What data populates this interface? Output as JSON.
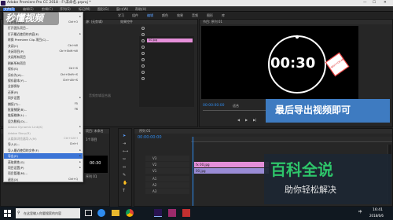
{
  "app": {
    "title": "Adobe Premiere Pro CC 2018 - F:\\未命名.prproj *",
    "menus": [
      "文件(F)",
      "编辑(E)",
      "剪辑(C)",
      "序列(S)",
      "标记(M)",
      "图形(G)",
      "窗口(W)",
      "帮助(H)"
    ]
  },
  "watermark_top": "秒懂视频",
  "header_tabs": [
    "学习",
    "组件",
    "编辑",
    "颜色",
    "效果",
    "音频",
    "图形",
    "库"
  ],
  "source_panel": {
    "tab": "源: (无剪辑)",
    "effects_tab": "效果控件",
    "mixer_tab": "音频剪辑混合器",
    "metadata_tab": "元数据"
  },
  "program_panel": {
    "tab": "节目: 序列 01",
    "clock_text": "00:30",
    "stamp_text": "WAIT FOR ME",
    "timecode": "00:00:00:00",
    "fit": "适合",
    "full": "完整"
  },
  "banner": {
    "text": "最后导出视频即可"
  },
  "baike": {
    "title": "百科全说",
    "subtitle": "助你轻松解决"
  },
  "project_panel": {
    "tab": "项目: 未命名",
    "clip": "序列 01",
    "mini_time": "00:30",
    "item_count": "1个项目"
  },
  "timeline": {
    "tab": "序列 01",
    "timecode": "00:00:00:00",
    "video_tracks": [
      "V3",
      "V2",
      "V1"
    ],
    "audio_tracks": [
      "A1",
      "A2",
      "A3"
    ],
    "clip_v1": "fx 00.jpg",
    "clip_v2": "00.jpg"
  },
  "file_menu": [
    {
      "label": "新建(N)",
      "shortcut": "",
      "submenu": true
    },
    {
      "label": "打开项目(O)...",
      "shortcut": "Ctrl+O"
    },
    {
      "label": "打开团队项目...",
      "shortcut": ""
    },
    {
      "label": "打开最近使用的内容(E)",
      "shortcut": "",
      "submenu": true
    },
    {
      "label": "转换 Premiere Clip 项目(C)...",
      "shortcut": ""
    },
    {
      "label": "关闭(C)",
      "shortcut": "Ctrl+W"
    },
    {
      "label": "关闭项目(P)",
      "shortcut": "Ctrl+Shift+W"
    },
    {
      "label": "关闭所有项目",
      "shortcut": ""
    },
    {
      "label": "刷新所有项目",
      "shortcut": ""
    },
    {
      "label": "保存(S)",
      "shortcut": "Ctrl+S"
    },
    {
      "label": "另存为(A)...",
      "shortcut": "Ctrl+Shift+S"
    },
    {
      "label": "保存副本(Y)...",
      "shortcut": "Ctrl+Alt+S"
    },
    {
      "label": "全部保存",
      "shortcut": ""
    },
    {
      "label": "还原(R)",
      "shortcut": ""
    },
    {
      "label": "同步设置",
      "shortcut": "",
      "submenu": true
    },
    {
      "label": "捕捉(T)...",
      "shortcut": "F5"
    },
    {
      "label": "批量捕捉(B)...",
      "shortcut": "F6"
    },
    {
      "label": "链接媒体(L)...",
      "shortcut": ""
    },
    {
      "label": "设为脱机(O)...",
      "shortcut": ""
    },
    {
      "label": "Adobe Dynamic Link(K)",
      "shortcut": "",
      "submenu": true,
      "disabled": true
    },
    {
      "label": "Adobe Story(R)",
      "shortcut": "",
      "submenu": true,
      "disabled": true
    },
    {
      "label": "从媒体浏览器导入(M)",
      "shortcut": "Ctrl+Alt+I",
      "disabled": true
    },
    {
      "label": "导入(I)...",
      "shortcut": "Ctrl+I"
    },
    {
      "label": "导入最近使用的文件(F)",
      "shortcut": "",
      "submenu": true
    },
    {
      "label": "导出(E)",
      "shortcut": "",
      "submenu": true,
      "highlight": true
    },
    {
      "label": "获取属性(G)",
      "shortcut": "",
      "submenu": true
    },
    {
      "label": "项目设置(P)",
      "shortcut": "",
      "submenu": true
    },
    {
      "label": "项目管理(M)...",
      "shortcut": ""
    },
    {
      "label": "退出(X)",
      "shortcut": "Ctrl+Q"
    }
  ],
  "taskbar": {
    "search_placeholder": "在这里输入你要搜索的内容",
    "time": "16:41",
    "date": "2018/6/6",
    "lang": "中"
  },
  "colors": {
    "accent_blue": "#2e8cf0",
    "menu_highlight": "#3b74d6",
    "clip_pink": "#e58fd9",
    "clip_purple": "#9a8cd6",
    "banner_blue": "#4182cd",
    "baike_green": "#2ec56a"
  }
}
